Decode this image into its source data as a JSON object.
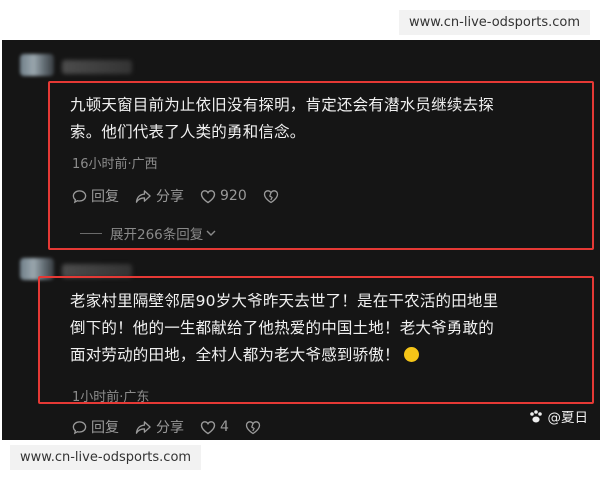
{
  "watermark_top": "www.cn-live-odsports.com",
  "watermark_bottom": "www.cn-live-odsports.com",
  "comments": [
    {
      "text_line1": "九顿天窗目前为止依旧没有探明，肯定还会有潜水员继续去探",
      "text_line2": "索。他们代表了人类的勇和信念。",
      "meta": "16小时前·广西",
      "reply_label": "回复",
      "share_label": "分享",
      "likes": "920"
    },
    {
      "text_line1": "老家村里隔壁邻居90岁大爷昨天去世了！是在干农活的田地里",
      "text_line2": "倒下的！他的一生都献给了他热爱的中国土地！老大爷勇敢的",
      "text_line3": "面对劳动的田地，全村人都为老大爷感到骄傲！",
      "meta": "1小时前·广东",
      "reply_label": "回复",
      "share_label": "分享",
      "likes": "4"
    }
  ],
  "expand_replies": "展开266条回复",
  "credit": "@夏日",
  "colors": {
    "highlight_border": "#e53935",
    "panel_bg": "#151515"
  }
}
